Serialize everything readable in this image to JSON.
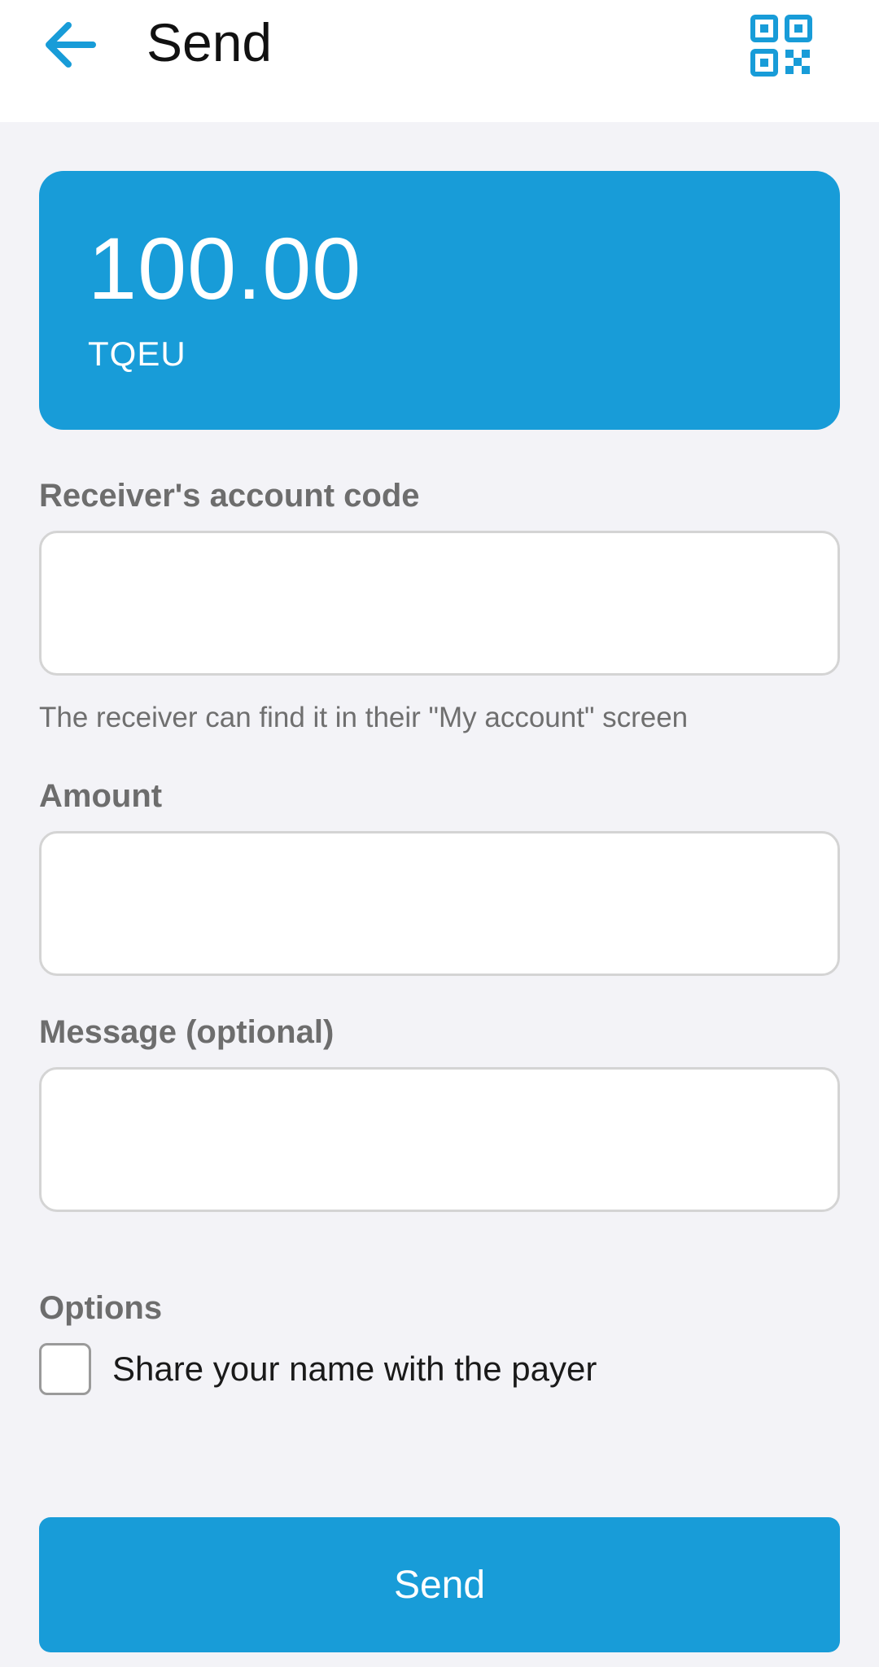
{
  "header": {
    "title": "Send",
    "back_icon": "arrow-left-icon",
    "qr_icon": "qr-code-icon"
  },
  "balance": {
    "amount": "100.00",
    "currency": "TQEU"
  },
  "form": {
    "receiver": {
      "label": "Receiver's account code",
      "value": "",
      "hint": "The receiver can find it in their \"My account\" screen"
    },
    "amount": {
      "label": "Amount",
      "value": ""
    },
    "message": {
      "label": "Message (optional)",
      "value": ""
    }
  },
  "options": {
    "label": "Options",
    "share_name": {
      "label": "Share your name with the payer",
      "checked": false
    }
  },
  "actions": {
    "send_label": "Send"
  },
  "colors": {
    "accent": "#189cd8",
    "background": "#f3f3f7",
    "label": "#6d6d6d"
  }
}
